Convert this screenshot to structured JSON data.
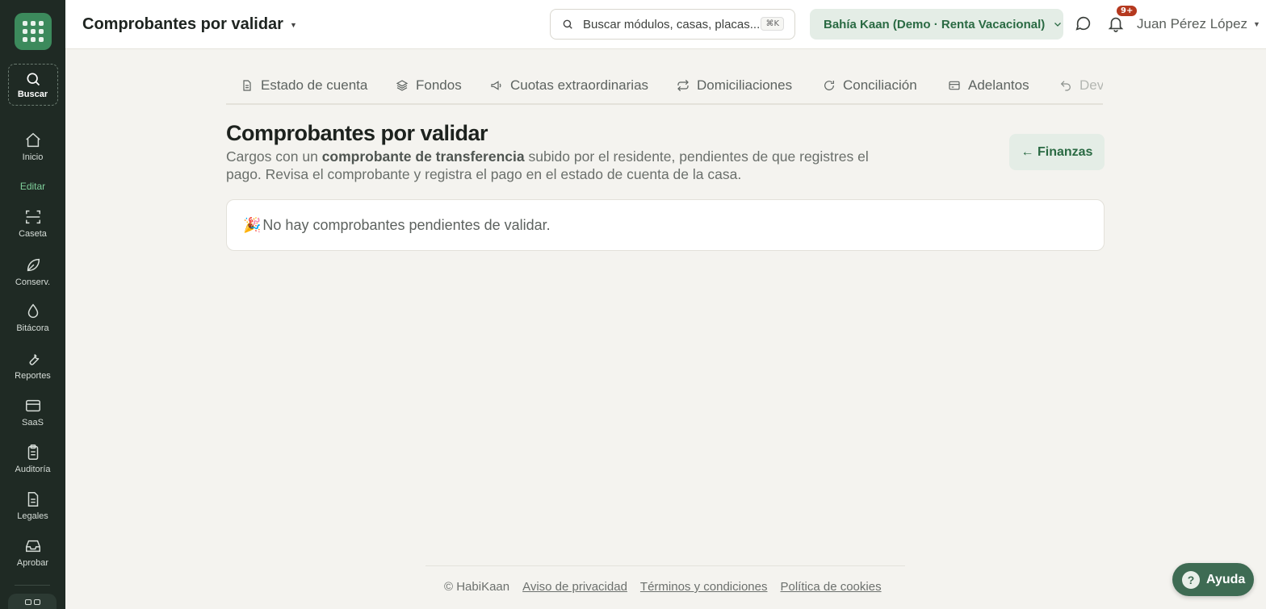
{
  "sidebar": {
    "search_label": "Buscar",
    "section_label": "Editar",
    "items": [
      {
        "label": "Inicio",
        "icon": "home-icon"
      },
      {
        "label": "Caseta",
        "icon": "scan-icon"
      },
      {
        "label": "Conserv.",
        "icon": "leaf-icon"
      },
      {
        "label": "Bitácora",
        "icon": "droplet-icon"
      },
      {
        "label": "Reportes",
        "icon": "wrench-icon"
      },
      {
        "label": "SaaS",
        "icon": "credit-card-icon"
      },
      {
        "label": "Auditoría",
        "icon": "clipboard-icon"
      },
      {
        "label": "Legales",
        "icon": "document-icon"
      },
      {
        "label": "Aprobar",
        "icon": "inbox-icon"
      }
    ]
  },
  "header": {
    "page_title": "Comprobantes por validar",
    "search_placeholder": "Buscar módulos, casas, placas...",
    "search_shortcut": "⌘K",
    "org_name": "Bahía Kaan (Demo · Renta Vacacional)",
    "notifications_badge": "9+",
    "user_name": "Juan Pérez López"
  },
  "tabs": [
    {
      "label": "Estado de cuenta",
      "icon": "file-text-icon"
    },
    {
      "label": "Fondos",
      "icon": "layers-icon"
    },
    {
      "label": "Cuotas extraordinarias",
      "icon": "megaphone-icon"
    },
    {
      "label": "Domiciliaciones",
      "icon": "repeat-icon"
    },
    {
      "label": "Conciliación",
      "icon": "refresh-icon"
    },
    {
      "label": "Adelantos",
      "icon": "wallet-icon"
    },
    {
      "label": "Dev",
      "icon": "undo-icon"
    }
  ],
  "main": {
    "title": "Comprobantes por validar",
    "desc_pre": "Cargos con un ",
    "desc_bold": "comprobante de transferencia",
    "desc_post": " subido por el residente, pendientes de que registres el pago. Revisa el comprobante y registra el pago en el estado de cuenta de la casa.",
    "back_button": "← Finanzas",
    "empty_emoji": "🎉",
    "empty_message": "No hay comprobantes pendientes de validar."
  },
  "footer": {
    "copyright": "© HabiKaan",
    "links": [
      "Aviso de privacidad",
      "Términos y condiciones",
      "Política de cookies"
    ]
  },
  "help_button": "Ayuda",
  "colors": {
    "sidebar_bg": "#1f2a24",
    "accent": "#2a6a43",
    "accent_bg": "#e4ede6",
    "page_bg": "#f4f3ef",
    "badge": "#b5391f"
  }
}
